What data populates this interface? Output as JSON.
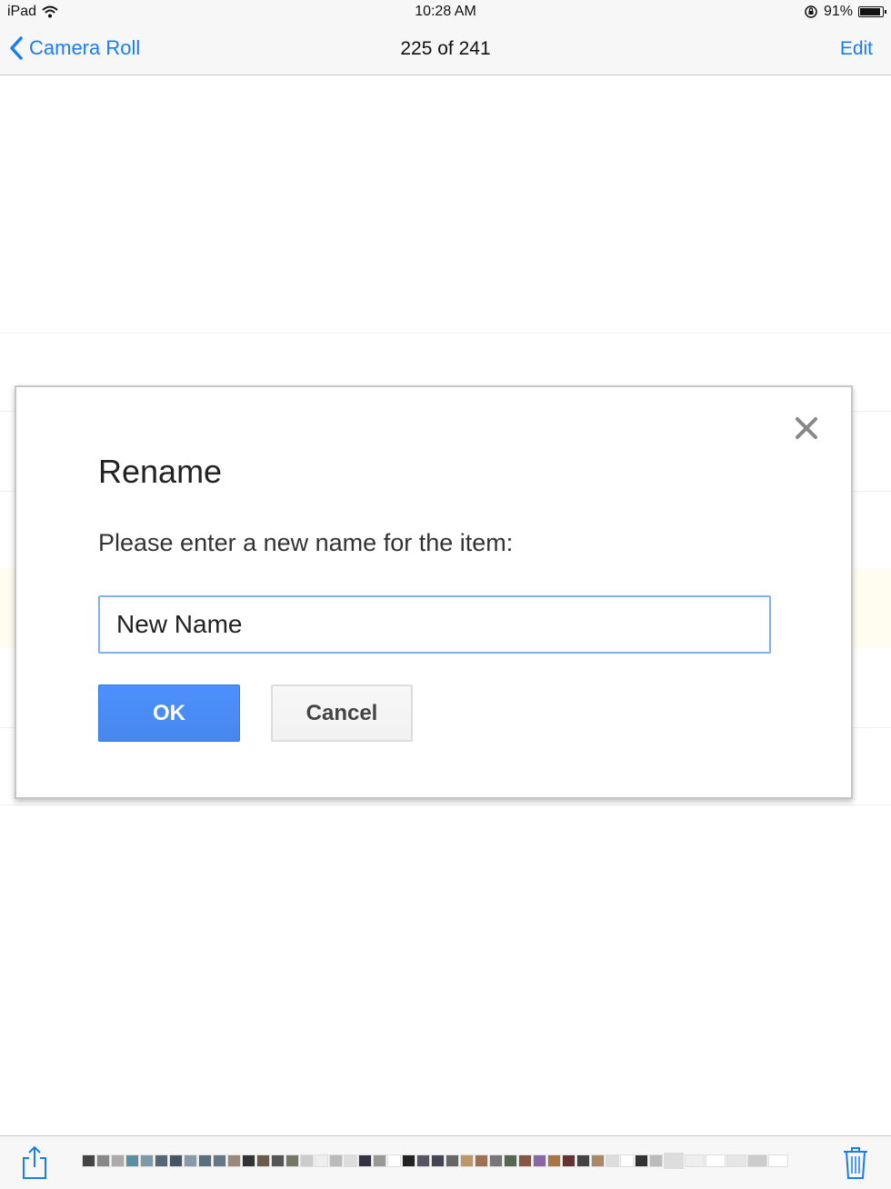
{
  "status_bar": {
    "device": "iPad",
    "time": "10:28 AM",
    "battery_text": "91%",
    "battery_level": 0.91,
    "icons": [
      "wifi-icon",
      "rotation-lock-icon",
      "battery-icon"
    ]
  },
  "nav_bar": {
    "back_label": "Camera Roll",
    "title": "225 of 241",
    "edit_label": "Edit",
    "accent_color": "#1a7cf3"
  },
  "dialog": {
    "title": "Rename",
    "message": "Please enter a new name for the item:",
    "input_value": "New Name",
    "ok_label": "OK",
    "cancel_label": "Cancel",
    "close_icon": "close-icon",
    "ok_color": "#4a8af4"
  },
  "toolbar": {
    "share_icon": "share-icon",
    "trash_icon": "trash-icon",
    "thumbnail_colors": [
      "#444444",
      "#888888",
      "#aaaaaa",
      "#5a8fa0",
      "#7a9aa8",
      "#556677",
      "#445566",
      "#8899aa",
      "#5a7080",
      "#667788",
      "#9a8878",
      "#333333",
      "#6a5a4a",
      "#555555",
      "#777766",
      "#cccccc",
      "#eeeeee",
      "#bbbbbb",
      "#dddddd",
      "#333344",
      "#999999",
      "#ffffff",
      "#222222",
      "#555566",
      "#444455",
      "#666666",
      "#bb9966",
      "#a07050",
      "#777777",
      "#556655",
      "#885544",
      "#8866aa",
      "#aa7744",
      "#663333",
      "#444444",
      "#aa8866",
      "#dddddd",
      "#ffffff",
      "#333333",
      "#bbbbbb",
      "#dddddd",
      "#eeeeee",
      "#ffffff",
      "#e6e6e6",
      "#cccccc",
      "#ffffff"
    ]
  }
}
